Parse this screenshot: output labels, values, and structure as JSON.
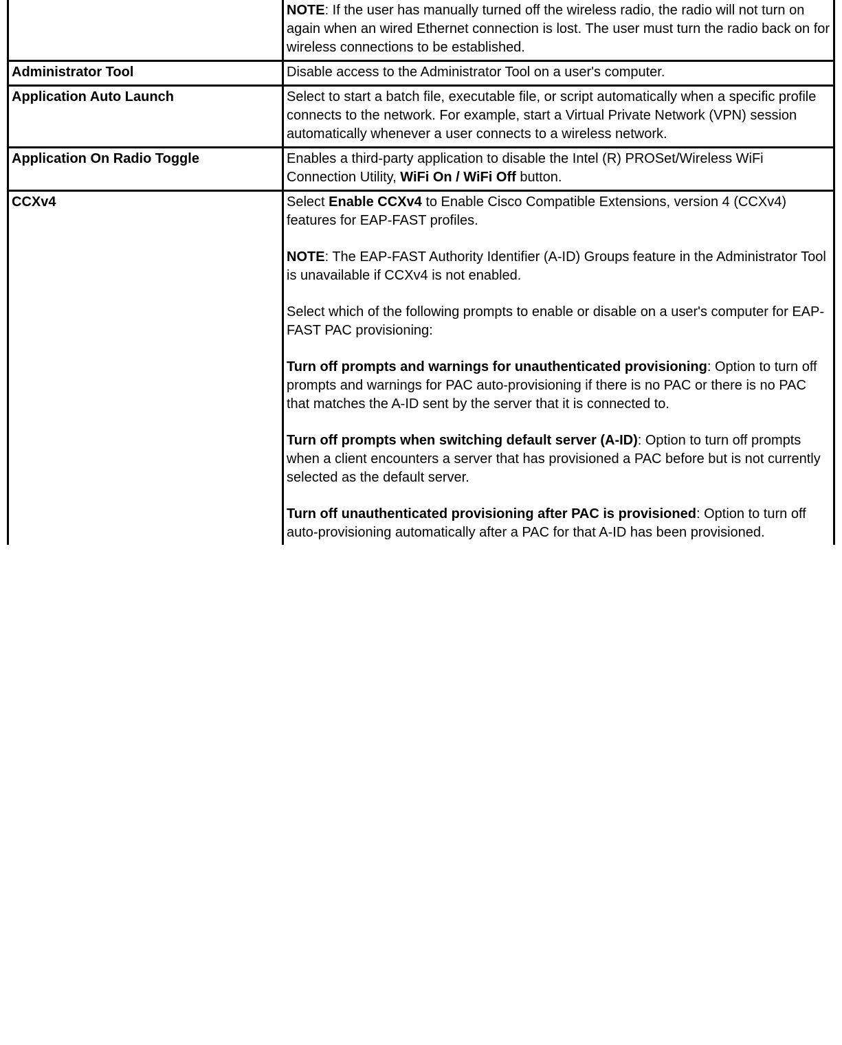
{
  "rows": [
    {
      "name": "",
      "desc_html": "<p class=\"para\"><b>NOTE</b>: If the user has manually turned off the wireless radio, the radio will not turn on again when an wired Ethernet connection is lost. The user must turn the radio back on for wireless connections to be established.</p>",
      "hide_top_border": true
    },
    {
      "name": "Administrator Tool",
      "desc_html": "Disable access to the Administrator Tool on a user's computer."
    },
    {
      "name": "Application Auto Launch",
      "desc_html": "Select to start a batch file, executable file, or script automatically when a specific profile connects to the network. For example, start a Virtual Private Network (VPN) session automatically whenever a user connects to a wireless network."
    },
    {
      "name": "Application On Radio Toggle",
      "desc_html": "Enables a third-party application to disable the Intel (R) PROSet/Wireless WiFi Connection Utility, <b>WiFi On / WiFi Off</b> button."
    },
    {
      "name": "CCXv4",
      "desc_html": "<p class=\"para\">Select <b>Enable CCXv4</b> to Enable Cisco Compatible Extensions, version 4 (CCXv4) features for EAP-FAST profiles.</p><p class=\"para\"><b>NOTE</b>: The EAP-FAST Authority Identifier (A-ID) Groups feature in the Administrator Tool is unavailable if CCXv4 is not enabled.</p><p class=\"para\">Select which of the following prompts to enable or disable on a user's computer for EAP-FAST PAC provisioning:</p><p class=\"para\"><b>Turn off prompts and warnings for unauthenticated provisioning</b>: Option to turn off prompts and warnings for PAC auto-provisioning if there is no PAC or there is no PAC that matches the A-ID sent by the server that it is connected to.</p><p class=\"para\"><b>Turn off prompts when switching default server (A-ID)</b>: Option to turn off prompts when a client encounters a server that has provisioned a PAC before but is not currently selected as the default server.</p><p class=\"para\"><b>Turn off unauthenticated provisioning after PAC is provisioned</b>: Option to turn off auto-provisioning automatically after a PAC for that A-ID has been provisioned.</p>",
      "hide_bottom_border": true
    }
  ]
}
